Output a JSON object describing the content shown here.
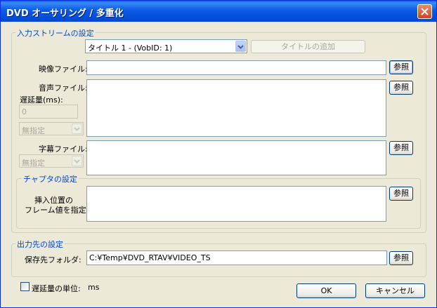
{
  "window": {
    "title": "DVD オーサリング / 多重化"
  },
  "input_group": {
    "legend": "入力ストリームの設定",
    "title_select": "タイトル 1 - (VobID: 1)",
    "add_title_button": "タイトルの追加",
    "video_label": "映像ファイル:",
    "video_value": "",
    "browse_label": "参照",
    "audio_label": "音声ファイル:",
    "delay_label": "遅延量(ms):",
    "delay_value": "0",
    "audio_lang": "無指定",
    "subtitle_label": "字幕ファイル:",
    "subtitle_lang": "無指定"
  },
  "chapter_group": {
    "legend": "チャプタの設定",
    "label_line1": "挿入位置の",
    "label_line2": "フレーム値を指定"
  },
  "output_group": {
    "legend": "出力先の設定",
    "folder_label": "保存先フォルダ:",
    "folder_value": "C:¥Temp¥DVD_RTAV¥VIDEO_TS"
  },
  "footer": {
    "delay_unit_label": "遅延量の単位:",
    "delay_unit_value": "ms",
    "ok_label": "OK",
    "cancel_label": "キャンセル"
  },
  "icons": {
    "close": "close-icon",
    "dropdown": "chevron-down-icon"
  }
}
